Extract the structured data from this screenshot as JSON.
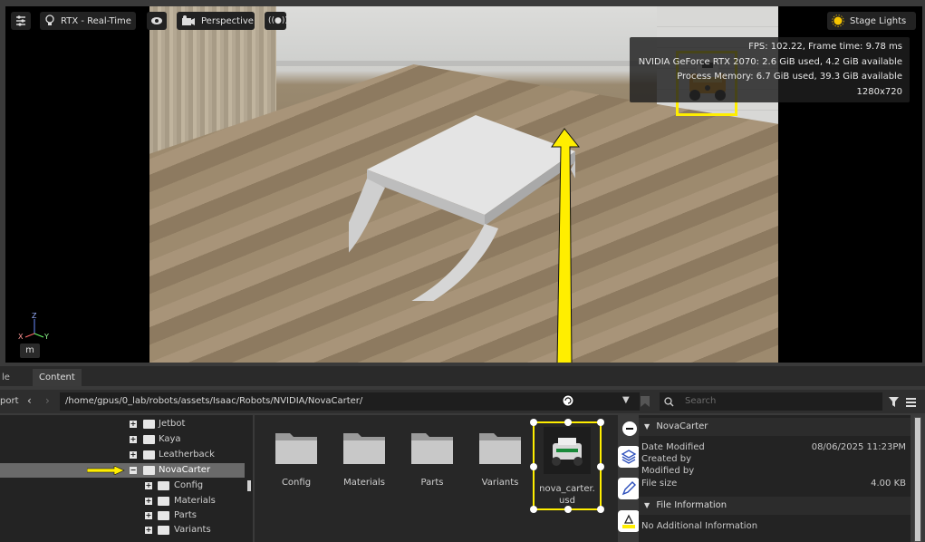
{
  "toolbar": {
    "rtx_label": "RTX - Real-Time",
    "camera_label": "Perspective",
    "lights_label": "Stage Lights"
  },
  "stats": {
    "line1": "FPS: 102.22, Frame time: 9.78 ms",
    "line2": "NVIDIA GeForce RTX 2070: 2.6 GiB used, 4.2 GiB available",
    "line3": "Process Memory: 6.7 GiB used, 39.3 GiB available",
    "line4": "1280x720"
  },
  "axis": {
    "z": "Z",
    "x": "X",
    "y": "Y"
  },
  "viewport_mode_label": "m",
  "tabs": {
    "left": "le",
    "content": "Content"
  },
  "pathbar": {
    "left_label": "port",
    "path": "/home/gpus/0_lab/robots/assets/Isaac/Robots/NVIDIA/NovaCarter/",
    "search_placeholder": "Search"
  },
  "tree": [
    {
      "label": "Jetbot"
    },
    {
      "label": "Kaya"
    },
    {
      "label": "Leatherback"
    },
    {
      "label": "NovaCarter"
    },
    {
      "label": "Config"
    },
    {
      "label": "Materials"
    },
    {
      "label": "Parts"
    },
    {
      "label": "Variants"
    }
  ],
  "files": [
    {
      "label": "Config"
    },
    {
      "label": "Materials"
    },
    {
      "label": "Parts"
    },
    {
      "label": "Variants"
    },
    {
      "label_line1": "nova_carter.",
      "label_line2": "usd"
    }
  ],
  "details": {
    "folder_name": "NovaCarter",
    "date_modified_label": "Date Modified",
    "date_modified_value": "08/06/2025 11:23PM",
    "created_by_label": "Created by",
    "modified_by_label": "Modified by",
    "file_size_label": "File size",
    "file_size_value": "4.00 KB",
    "file_info_header": "File Information",
    "no_info_text": "No Additional Information"
  },
  "colors": {
    "highlight": "#ffee00",
    "selection_row": "#6a6a6a"
  },
  "icons": [
    "settings-icon",
    "bulb-icon",
    "eye-icon",
    "camera-icon",
    "broadcast-icon",
    "sun-icon",
    "filter-icon",
    "menu-icon",
    "search-icon",
    "bookmark-icon",
    "refresh-icon",
    "layers-icon",
    "pen-icon",
    "paint-icon",
    "minus-icon"
  ]
}
